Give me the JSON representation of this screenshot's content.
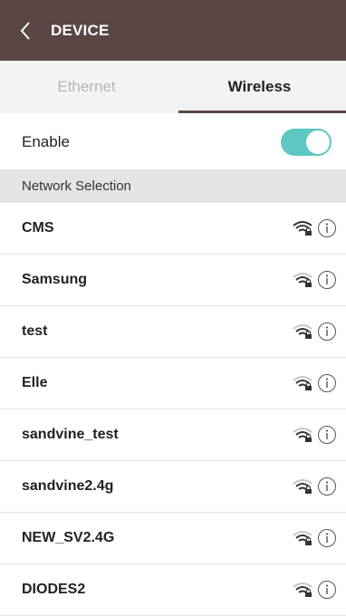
{
  "header": {
    "title": "DEVICE"
  },
  "tabs": [
    {
      "label": "Ethernet",
      "active": false
    },
    {
      "label": "Wireless",
      "active": true
    }
  ],
  "enable": {
    "label": "Enable",
    "on": true,
    "color": "#5ec7c3"
  },
  "network_section": {
    "title": "Network Selection"
  },
  "networks": [
    {
      "name": "CMS",
      "icon": "wifi-lock-icon"
    },
    {
      "name": "Samsung",
      "icon": "wifi-lock-icon"
    },
    {
      "name": "test",
      "icon": "wifi-lock-icon"
    },
    {
      "name": "Elle",
      "icon": "wifi-lock-icon"
    },
    {
      "name": "sandvine_test",
      "icon": "wifi-lock-icon"
    },
    {
      "name": "sandvine2.4g",
      "icon": "wifi-lock-icon"
    },
    {
      "name": "NEW_SV2.4G",
      "icon": "wifi-lock-icon"
    },
    {
      "name": "DIODES2",
      "icon": "wifi-lock-icon"
    }
  ],
  "colors": {
    "header_bg": "#5b4646",
    "accent": "#5ec7c3"
  }
}
